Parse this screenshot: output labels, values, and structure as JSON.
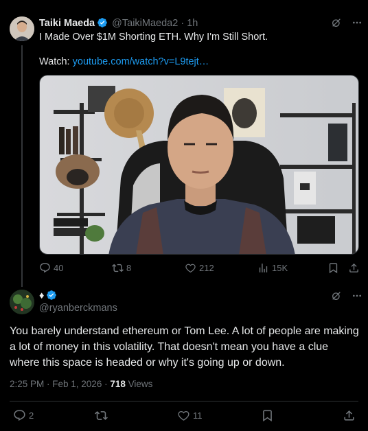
{
  "post": {
    "author_name": "Taiki Maeda",
    "handle": "@TaikiMaeda2",
    "separator": "·",
    "time": "1h",
    "text": "I Made Over $1M Shorting ETH. Why I'm Still Short.",
    "watch_label": "Watch:",
    "link": "youtube.com/watch?v=L9tejt…",
    "actions": {
      "replies": "40",
      "reposts": "8",
      "likes": "212",
      "views": "15K"
    }
  },
  "reply": {
    "display_symbol": "♦",
    "handle": "@ryanberckmans",
    "text": "You barely understand ethereum or Tom Lee. A lot of people are making a lot of money in this volatility. That doesn't mean you have a clue where this space is headed or why it's going up or down.",
    "timestamp": "2:25 PM · Feb 1, 2026 · ",
    "view_count": "718",
    "views_label": " Views",
    "actions": {
      "replies": "2",
      "likes": "11"
    }
  },
  "colors": {
    "background": "#000000",
    "text": "#e7e9ea",
    "muted": "#71767b",
    "link": "#1d9bf0",
    "verified": "#1d9bf0",
    "divider": "#2f3336"
  },
  "icons": [
    "grok-icon",
    "more-icon",
    "reply-icon",
    "repost-icon",
    "like-icon",
    "views-icon",
    "bookmark-icon",
    "share-icon",
    "verified-badge-icon"
  ]
}
